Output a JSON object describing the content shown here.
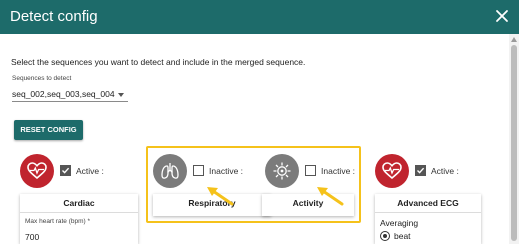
{
  "dialog": {
    "title": "Detect config",
    "close_icon": "close-icon"
  },
  "instruction": "Select the sequences you want to detect and include in the merged sequence.",
  "sequences": {
    "label": "Sequences to detect",
    "value": "seq_002,seq_003,seq_004"
  },
  "reset_button": "RESET CONFIG",
  "modules": [
    {
      "name": "Cardiac",
      "status": "Active :",
      "checked": true,
      "icon": "heart-pulse-icon"
    },
    {
      "name": "Respiratory",
      "status": "Inactive :",
      "checked": false,
      "icon": "lungs-icon"
    },
    {
      "name": "Activity",
      "status": "Inactive :",
      "checked": false,
      "icon": "activity-icon"
    },
    {
      "name": "Advanced ECG",
      "status": "Active :",
      "checked": true,
      "icon": "heart-pulse-icon"
    }
  ],
  "cardiac": {
    "max_hr_label": "Max heart rate (bpm) *",
    "max_hr_value": "700"
  },
  "advanced_ecg": {
    "averaging_label": "Averaging",
    "averaging_option": "beat"
  },
  "colors": {
    "header": "#1d6b6a",
    "active_icon_bg": "#c0242e",
    "inactive_icon_bg": "#7b7b7b",
    "highlight": "#f5c21b"
  }
}
